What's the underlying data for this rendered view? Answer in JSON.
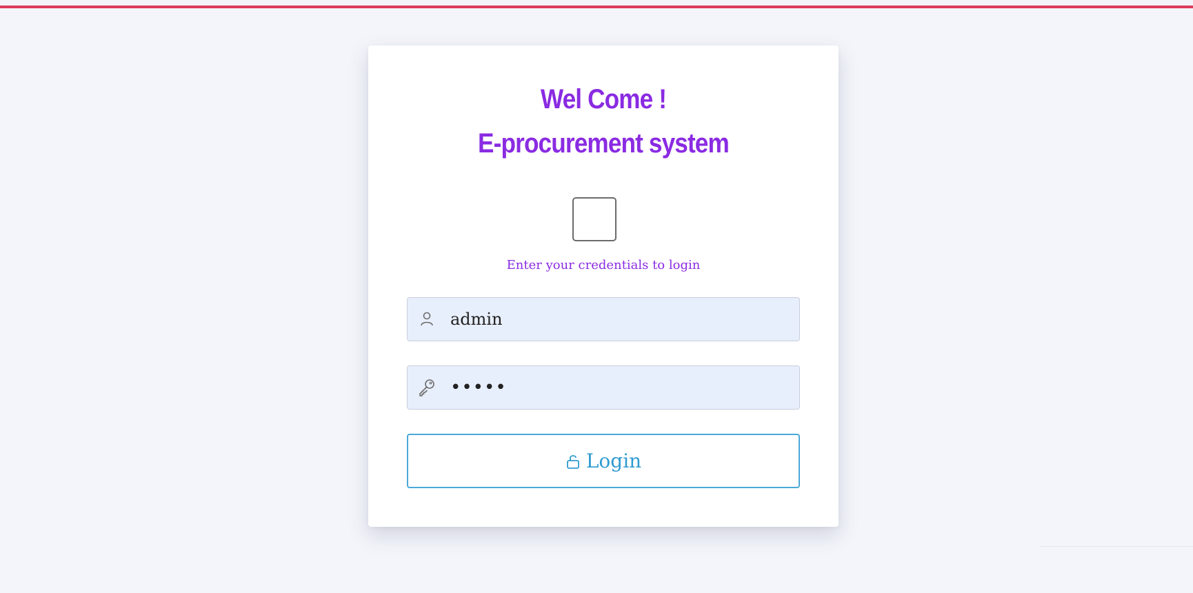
{
  "header": {
    "title_line1": "Wel Come !",
    "title_line2": "E-procurement system"
  },
  "logo": {
    "icon": "logo-placeholder"
  },
  "form": {
    "subtitle": "Enter your credentials to login",
    "username": {
      "icon": "user-icon",
      "value": "admin"
    },
    "password": {
      "icon": "key-icon",
      "value": "•••••"
    },
    "login_button": {
      "icon": "unlock-icon",
      "label": "Login"
    }
  },
  "colors": {
    "accent": "#8a2be2",
    "button": "#2f9bd0",
    "top_bar": "#dc3b5b",
    "input_bg": "#e8effc",
    "page_bg": "#f3f5fa"
  }
}
